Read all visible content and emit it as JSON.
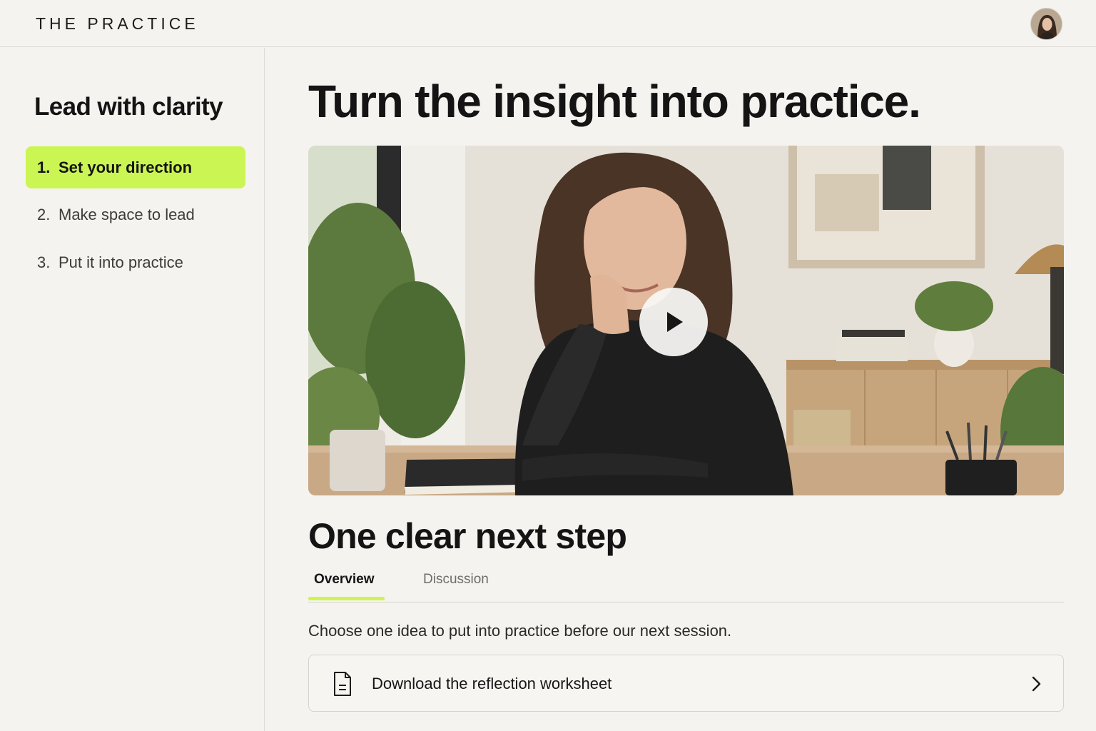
{
  "topbar": {
    "brand": "THE PRACTICE",
    "avatar_icon": "user-avatar"
  },
  "sidebar": {
    "course_title": "Lead with clarity",
    "steps": [
      {
        "number": "1.",
        "label": "Set your direction",
        "active": true
      },
      {
        "number": "2.",
        "label": "Make space to lead",
        "active": false
      },
      {
        "number": "3.",
        "label": "Put it into practice",
        "active": false
      }
    ]
  },
  "main": {
    "headline": "Turn the insight into practice.",
    "video": {
      "play_icon": "play-icon"
    },
    "section_title": "One clear next step",
    "tabs": [
      {
        "label": "Overview",
        "active": true
      },
      {
        "label": "Discussion",
        "active": false
      }
    ],
    "overview_text": "Choose one idea to put into practice before our next session.",
    "resource": {
      "label": "Download the reflection worksheet",
      "icon": "document-icon",
      "trailing_icon": "chevron-right-icon"
    }
  },
  "colors": {
    "accent": "#cbf553",
    "background": "#f5f3ef",
    "text": "#141414"
  }
}
